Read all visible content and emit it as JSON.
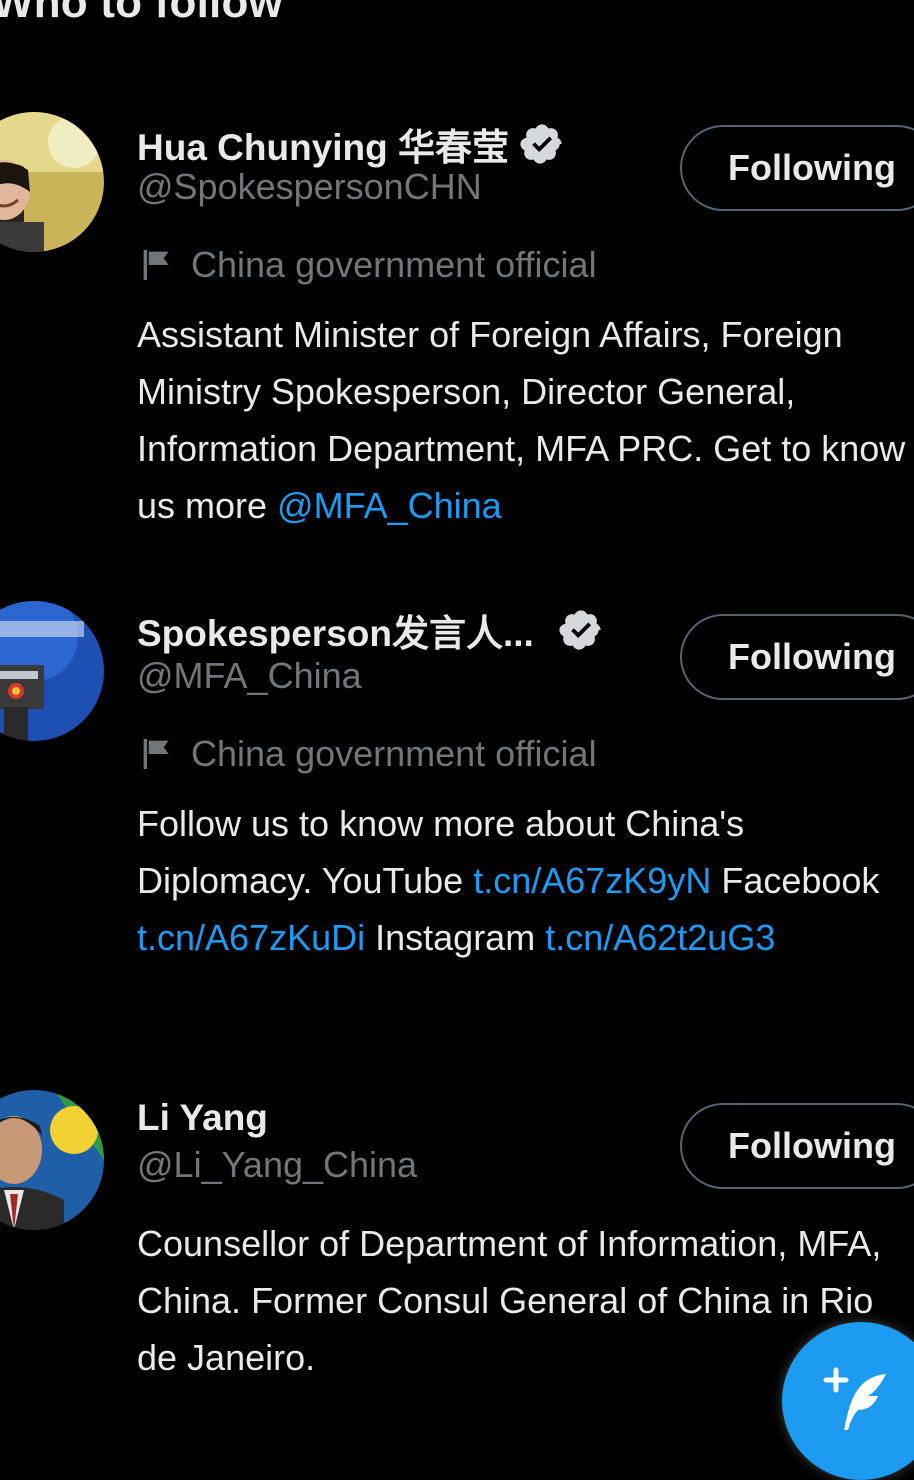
{
  "section": {
    "title": "Who to follow"
  },
  "accounts": [
    {
      "name": "Hua Chunying 华春莹",
      "handle": "@SpokespersonCHN",
      "label": "China government official",
      "bio": [
        {
          "text": "Assistant Minister of Foreign Affairs, Foreign Ministry Spokesperson, Director General, Information Department, MFA PRC. Get to know us more ",
          "link": false
        },
        {
          "text": "@MFA_China",
          "link": true
        }
      ],
      "button": "Following"
    },
    {
      "name": "Spokesperson发言人...",
      "handle": "@MFA_China",
      "label": "China government official",
      "bio": [
        {
          "text": "Follow us to know more about China's Diplomacy. YouTube ",
          "link": false
        },
        {
          "text": "t.cn/A67zK9yN",
          "link": true
        },
        {
          "text": " Facebook ",
          "link": false
        },
        {
          "text": "t.cn/A67zKuDi",
          "link": true
        },
        {
          "text": " Instagram ",
          "link": false
        },
        {
          "text": "t.cn/A62t2uG3",
          "link": true
        }
      ],
      "button": "Following"
    },
    {
      "name": "Li Yang",
      "handle": "@Li_Yang_China",
      "bio": [
        {
          "text": "Counsellor of Department of Information, MFA, China. Former Consul General of China in Rio de Janeiro.",
          "link": false
        }
      ],
      "button": "Following"
    }
  ],
  "fab": {
    "icon": "compose-tweet-icon"
  },
  "colors": {
    "background": "#000000",
    "text": "#e7e9ea",
    "secondary": "#71767b",
    "link": "#1d9bf0",
    "button_border": "#536471",
    "fab": "#1d9bf0"
  }
}
